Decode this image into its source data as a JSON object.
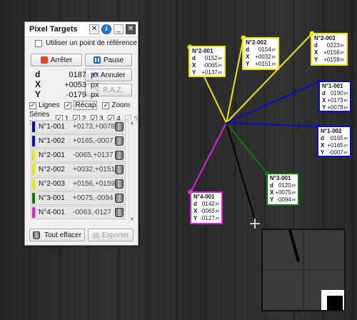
{
  "panel": {
    "title": "Pixel Targets",
    "use_reference_label": "Utiliser un point de référence",
    "stop_label": "Arrêter",
    "pause_label": "Pause",
    "undo_label": "Annuler",
    "reset_label": "R.A.Z.",
    "d_key": "d",
    "d_value": "0187",
    "d_unit": "px",
    "x_key": "X",
    "x_value": "+0053",
    "x_unit": "px",
    "y_key": "Y",
    "y_value": "-0179",
    "y_unit": "px",
    "lines_label": "Lignes",
    "recap_label": "Récap",
    "zoom_label": "Zoom",
    "series_label": "Séries :",
    "series": [
      "1",
      "2",
      "3",
      "4",
      "5"
    ],
    "clear_all_label": "Tout effacer",
    "export_label": "Exporter"
  },
  "items": [
    {
      "name": "N°1-001",
      "value": "+0173,+0078",
      "color": "#0a0ac8"
    },
    {
      "name": "N°1-002",
      "value": "+0165,-0007",
      "color": "#0a0ac8"
    },
    {
      "name": "N°2-001",
      "value": "-0065,+0137",
      "color": "#e8e800"
    },
    {
      "name": "N°2-002",
      "value": "+0032,+0151",
      "color": "#e8e800"
    },
    {
      "name": "N°2-003",
      "value": "+0156,+0159",
      "color": "#e8e800"
    },
    {
      "name": "N°3-001",
      "value": "+0075,-0094",
      "color": "#0a7a0a"
    },
    {
      "name": "N°4-001",
      "value": "-0063,-0127",
      "color": "#e020e0"
    }
  ],
  "labels": [
    {
      "name": "N°2-001",
      "d": "0152",
      "x": "-0065",
      "y": "+0137",
      "color": "#e8e800"
    },
    {
      "name": "N°2-002",
      "d": "0154",
      "x": "+0032",
      "y": "+0151",
      "color": "#e8e800"
    },
    {
      "name": "N°2-003",
      "d": "0223",
      "x": "+0156",
      "y": "+0159",
      "color": "#e8e800"
    },
    {
      "name": "N°1-001",
      "d": "0190",
      "x": "+0173",
      "y": "+0078",
      "color": "#0a0ac8"
    },
    {
      "name": "N°1-002",
      "d": "0165",
      "x": "+0165",
      "y": "-0007",
      "color": "#0a0ac8"
    },
    {
      "name": "N°3-001",
      "d": "0120",
      "x": "+0075",
      "y": "-0094",
      "color": "#0a7a0a"
    },
    {
      "name": "N°4-001",
      "d": "0142",
      "x": "-0063",
      "y": "-0127",
      "color": "#e020e0"
    }
  ],
  "unit_small": "px"
}
